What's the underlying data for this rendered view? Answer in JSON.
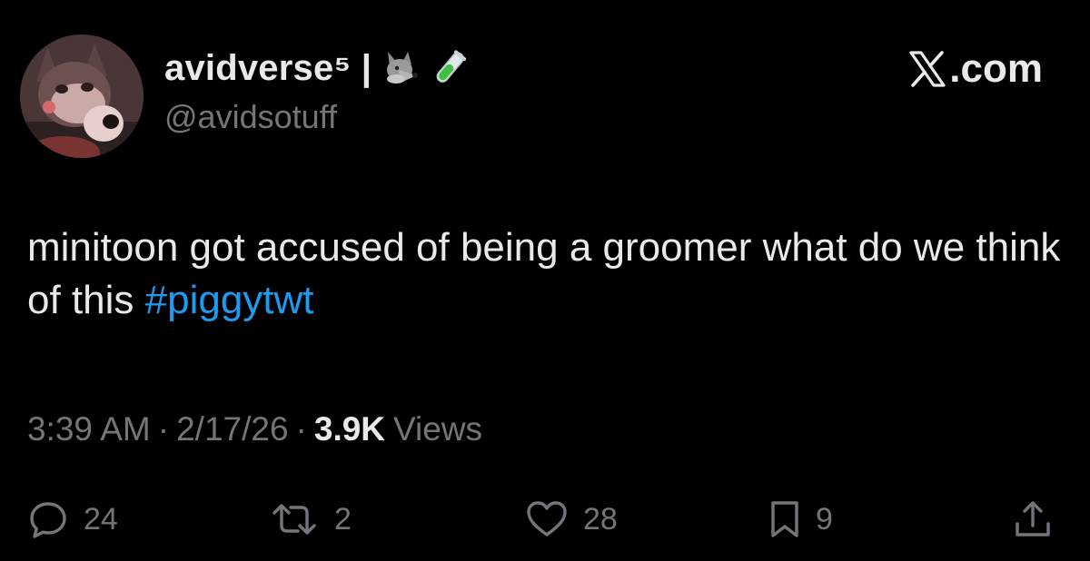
{
  "author": {
    "display_name": "avidverse⁵ |",
    "name_emojis": [
      "wolf-icon",
      "test-tube-icon"
    ],
    "handle": "@avidsotuff"
  },
  "brand": {
    "text": ".com",
    "icon": "x-logo-icon"
  },
  "tweet": {
    "text": "minitoon got accused of being a groomer what do we think of this ",
    "hashtag": "#piggytwt"
  },
  "meta": {
    "time": "3:39 AM",
    "separator": "·",
    "date": "2/17/26",
    "views_count": "3.9K",
    "views_label": "Views"
  },
  "actions": {
    "replies": "24",
    "reposts": "2",
    "likes": "28",
    "bookmarks": "9"
  },
  "colors": {
    "background": "#000000",
    "text_primary": "#e7e9ea",
    "text_secondary": "#71767b",
    "link": "#1d9bf0"
  }
}
